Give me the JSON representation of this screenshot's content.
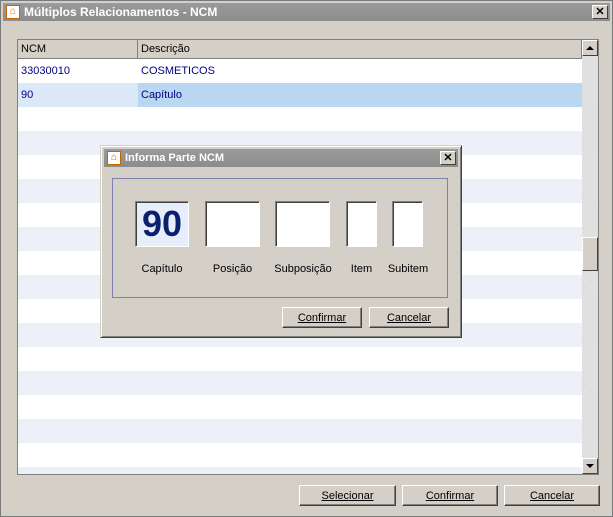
{
  "window": {
    "title": "Múltiplos Relacionamentos - NCM",
    "icon": "app-house-icon",
    "close_glyph": "✕"
  },
  "grid": {
    "columns": [
      "NCM",
      "Descrição"
    ],
    "rows": [
      {
        "ncm": "33030010",
        "descricao": "COSMETICOS"
      },
      {
        "ncm": "90",
        "descricao": "Capítulo",
        "selected": true
      }
    ]
  },
  "buttons": {
    "selecionar": "Selecionar",
    "confirmar": "Confirmar",
    "cancelar": "Cancelar"
  },
  "dialog": {
    "title": "Informa Parte NCM",
    "fields": {
      "capitulo": {
        "label": "Capítulo",
        "value": "90"
      },
      "posicao": {
        "label": "Posição",
        "value": ""
      },
      "subposicao": {
        "label": "Subposição",
        "value": ""
      },
      "item": {
        "label": "Item",
        "value": ""
      },
      "subitem": {
        "label": "Subitem",
        "value": ""
      }
    },
    "confirm_label": "Confirmar",
    "cancel_label": "Cancelar"
  },
  "colors": {
    "selected_row": "#b9d7f1",
    "row_text": "#000080",
    "alt_row": "#eef0f7",
    "titlebar": "#8c8c8c"
  }
}
